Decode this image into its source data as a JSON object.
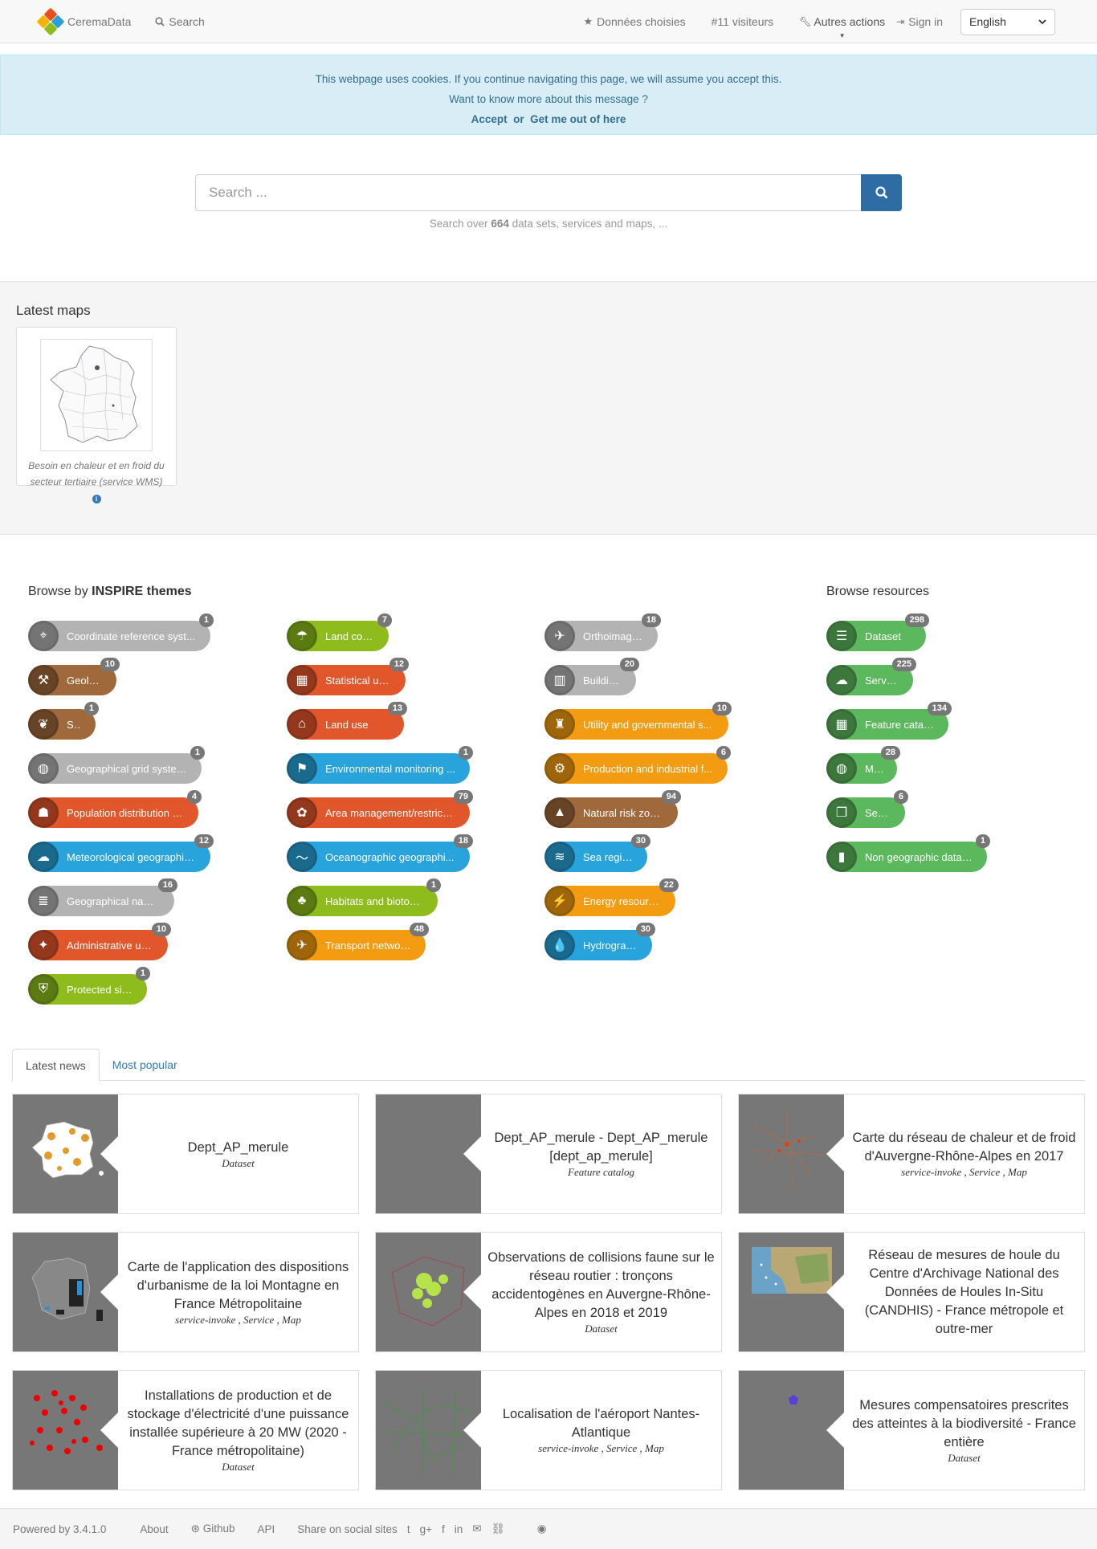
{
  "nav": {
    "brand": "CeremaData",
    "search": "Search",
    "chosen": "Données choisies",
    "visitors": "#11 visiteurs",
    "other_actions": "Autres actions",
    "sign_in": "Sign in",
    "language": "English"
  },
  "cookie": {
    "line1": "This webpage uses cookies. If you continue navigating this page, we will assume you accept this.",
    "line2": "Want to know more about this message ?",
    "accept": "Accept",
    "or": "or",
    "leave": "Get me out of here"
  },
  "search": {
    "placeholder": "Search ...",
    "hint_prefix": "Search over",
    "hint_count": "664",
    "hint_suffix": "data sets, services and maps, ..."
  },
  "latest_maps": {
    "title": "Latest maps",
    "items": [
      {
        "caption": "Besoin en chaleur et en froid du secteur tertiaire (service WMS)"
      }
    ]
  },
  "themes": {
    "title_prefix": "Browse by",
    "title_bold": "INSPIRE themes",
    "columns": [
      [
        {
          "label": "Coordinate reference syst...",
          "count": "1",
          "color": "grey",
          "icon": "⌖"
        },
        {
          "label": "Geology",
          "count": "10",
          "color": "brown",
          "icon": "⚒"
        },
        {
          "label": "Soil",
          "count": "1",
          "color": "brown",
          "icon": "❦"
        },
        {
          "label": "Geographical grid systems",
          "count": "1",
          "color": "grey",
          "icon": "◍"
        },
        {
          "label": "Population distribution — ...",
          "count": "4",
          "color": "orange",
          "icon": "☗"
        },
        {
          "label": "Meteorological geographic...",
          "count": "12",
          "color": "blue",
          "icon": "☁"
        },
        {
          "label": "Geographical names",
          "count": "16",
          "color": "grey",
          "icon": "≣"
        },
        {
          "label": "Administrative units",
          "count": "10",
          "color": "orange",
          "icon": "✦"
        },
        {
          "label": "Protected sites",
          "count": "1",
          "color": "green",
          "icon": "⛨"
        }
      ],
      [
        {
          "label": "Land cover",
          "count": "7",
          "color": "green",
          "icon": "☂"
        },
        {
          "label": "Statistical units",
          "count": "12",
          "color": "orange",
          "icon": "▦"
        },
        {
          "label": "Land use",
          "count": "13",
          "color": "orange",
          "icon": "⌂"
        },
        {
          "label": "Environmental monitoring ...",
          "count": "1",
          "color": "blue",
          "icon": "⚑"
        },
        {
          "label": "Area management/restricti...",
          "count": "79",
          "color": "orange",
          "icon": "✿"
        },
        {
          "label": "Oceanographic geographi...",
          "count": "18",
          "color": "blue",
          "icon": "〜"
        },
        {
          "label": "Habitats and biotopes",
          "count": "1",
          "color": "green",
          "icon": "♣"
        },
        {
          "label": "Transport networks",
          "count": "48",
          "color": "yellow",
          "icon": "✈"
        }
      ],
      [
        {
          "label": "Orthoimagery",
          "count": "18",
          "color": "grey",
          "icon": "✈"
        },
        {
          "label": "Buildings",
          "count": "20",
          "color": "grey",
          "icon": "▥"
        },
        {
          "label": "Utility and governmental s...",
          "count": "10",
          "color": "yellow",
          "icon": "♜"
        },
        {
          "label": "Production and industrial f...",
          "count": "6",
          "color": "yellow",
          "icon": "⚙"
        },
        {
          "label": "Natural risk zones",
          "count": "94",
          "color": "brown",
          "icon": "▲"
        },
        {
          "label": "Sea regions",
          "count": "30",
          "color": "blue",
          "icon": "≋"
        },
        {
          "label": "Energy resources",
          "count": "22",
          "color": "yellow",
          "icon": "⚡"
        },
        {
          "label": "Hydrography",
          "count": "30",
          "color": "blue",
          "icon": "💧"
        }
      ]
    ]
  },
  "resources": {
    "title": "Browse resources",
    "items": [
      {
        "label": "Dataset",
        "count": "298",
        "icon": "☰"
      },
      {
        "label": "Service",
        "count": "225",
        "icon": "☁"
      },
      {
        "label": "Feature catalog",
        "count": "134",
        "icon": "▦"
      },
      {
        "label": "Map",
        "count": "28",
        "icon": "◍"
      },
      {
        "label": "Series",
        "count": "6",
        "icon": "❐"
      },
      {
        "label": "Non geographic dataset",
        "count": "1",
        "icon": "▮"
      }
    ]
  },
  "news": {
    "tabs": [
      "Latest news",
      "Most popular"
    ],
    "cards": [
      {
        "title": "Dept_AP_merule",
        "meta": "Dataset",
        "thumb": "france-orange"
      },
      {
        "title": "Dept_AP_merule - Dept_AP_merule [dept_ap_merule]",
        "meta": "Feature catalog",
        "thumb": "none"
      },
      {
        "title": "Carte du réseau de chaleur et de froid d'Auvergne-Rhône-Alpes en 2017",
        "meta": "service-invoke , Service , Map",
        "thumb": "network-orange"
      },
      {
        "title": "Carte de l'application des dispositions d'urbanisme de la loi Montagne en France Métropolitaine",
        "meta": "service-invoke , Service , Map",
        "thumb": "france-blue"
      },
      {
        "title": "Observations de collisions faune sur le réseau routier : tronçons accidentogènes en Auvergne-Rhône-Alpes en 2018 et 2019",
        "meta": "Dataset",
        "thumb": "region-green"
      },
      {
        "title": "Réseau de mesures de houle du Centre d'Archivage National des Données de Houles In-Situ (CANDHIS) - France métropole et outre-mer",
        "meta": "",
        "thumb": "satellite"
      },
      {
        "title": "Installations de production et de stockage d'électricité d'une puissance installée supérieure à 20 MW (2020 - France métropolitaine)",
        "meta": "Dataset",
        "thumb": "red-dots"
      },
      {
        "title": "Localisation de l'aéroport Nantes-Atlantique",
        "meta": "service-invoke , Service , Map",
        "thumb": "green-lines"
      },
      {
        "title": "Mesures compensatoires prescrites des atteintes à la biodiversité - France entière",
        "meta": "Dataset",
        "thumb": "purple-dot"
      }
    ]
  },
  "footer": {
    "powered": "Powered by 3.4.1.0",
    "about": "About",
    "github": "Github",
    "api": "API",
    "share": "Share on social sites"
  },
  "colors": {
    "grey": "#b3b3b3",
    "brown": "#a0693b",
    "green": "#8dbc1c",
    "orange": "#e2562b",
    "blue": "#29a3db",
    "yellow": "#f39c12",
    "resource": "#5cb85c",
    "primary": "#337ab7"
  }
}
